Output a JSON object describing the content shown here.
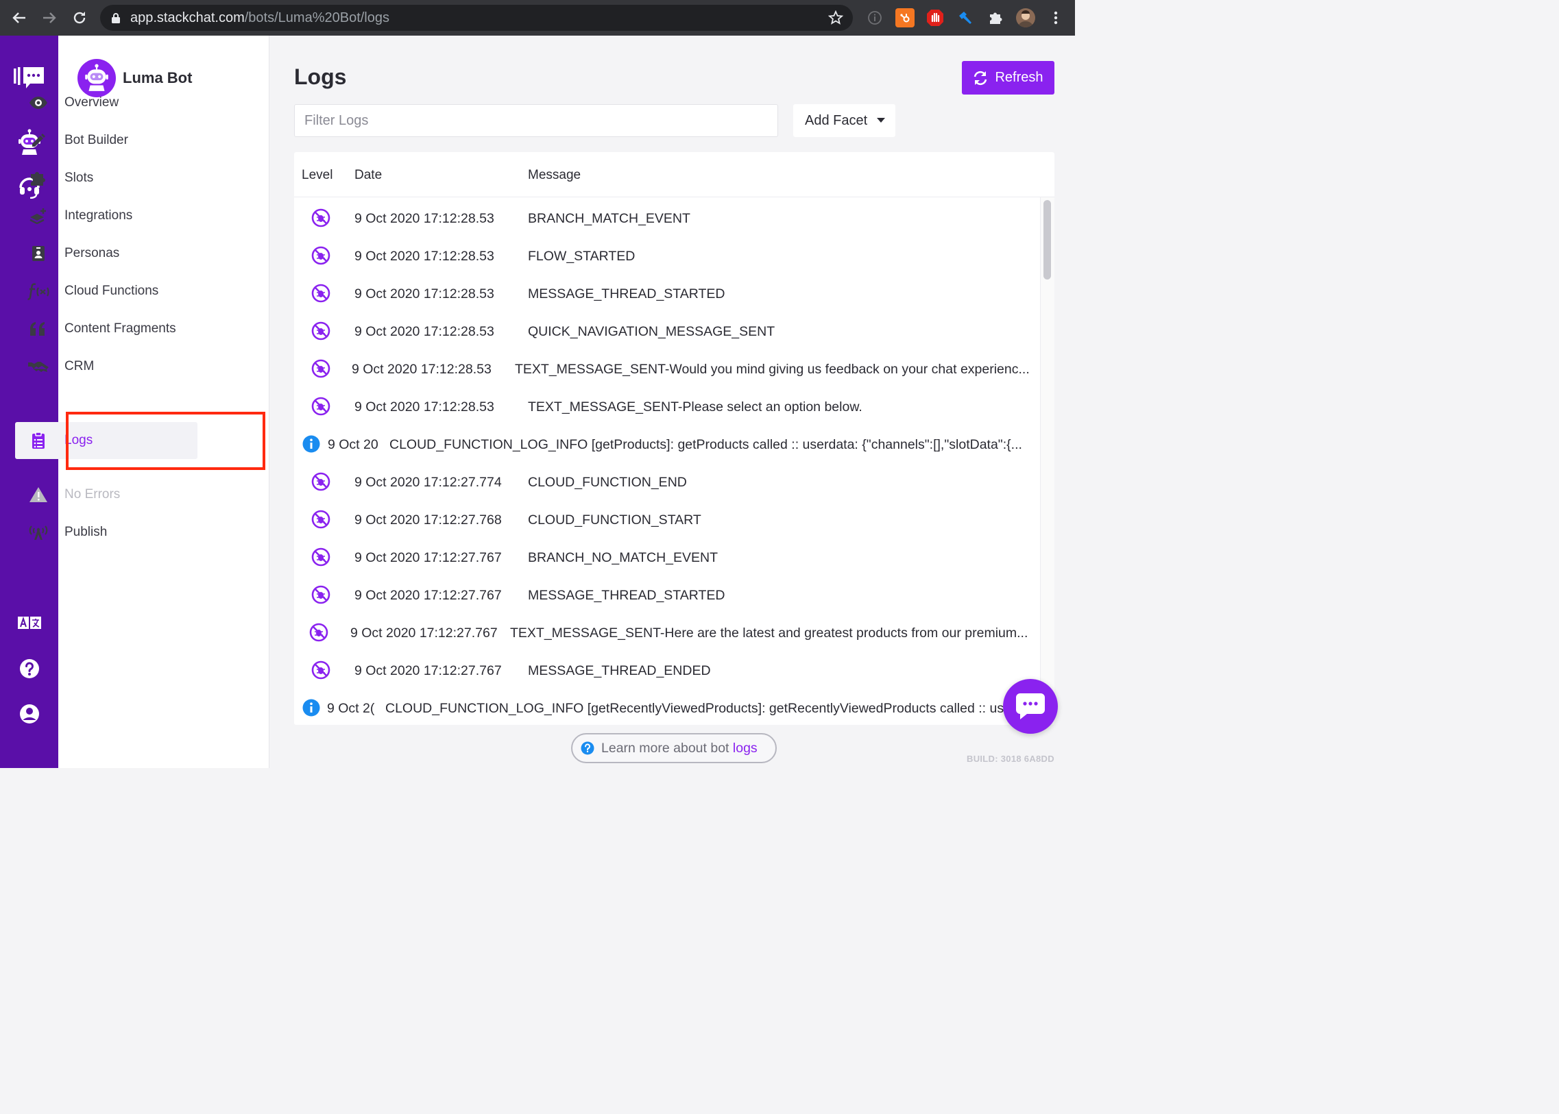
{
  "browser": {
    "url_host": "app.stackchat.com",
    "url_path": "/bots/Luma%20Bot/logs"
  },
  "bot": {
    "name": "Luma Bot"
  },
  "nav": {
    "items": [
      {
        "label": "Overview",
        "icon": "eye-icon"
      },
      {
        "label": "Bot Builder",
        "icon": "pencil-icon"
      },
      {
        "label": "Slots",
        "icon": "puzzle-icon"
      },
      {
        "label": "Integrations",
        "icon": "layers-plus-icon"
      },
      {
        "label": "Personas",
        "icon": "id-badge-icon"
      },
      {
        "label": "Cloud Functions",
        "icon": "function-icon"
      },
      {
        "label": "Content Fragments",
        "icon": "quote-icon"
      },
      {
        "label": "CRM",
        "icon": "handshake-icon"
      },
      {
        "label": "Logs",
        "icon": "clipboard-list-icon",
        "active": true
      }
    ],
    "errors_label": "No Errors",
    "publish_label": "Publish"
  },
  "main": {
    "title": "Logs",
    "refresh_label": "Refresh",
    "filter_placeholder": "Filter Logs",
    "facet_label": "Add Facet"
  },
  "table": {
    "headers": {
      "level": "Level",
      "date": "Date",
      "message": "Message"
    },
    "rows": [
      {
        "level": "debug",
        "date": "9 Oct 2020 17:12:28.53",
        "message": "BRANCH_MATCH_EVENT"
      },
      {
        "level": "debug",
        "date": "9 Oct 2020 17:12:28.53",
        "message": "FLOW_STARTED"
      },
      {
        "level": "debug",
        "date": "9 Oct 2020 17:12:28.53",
        "message": "MESSAGE_THREAD_STARTED"
      },
      {
        "level": "debug",
        "date": "9 Oct 2020 17:12:28.53",
        "message": "QUICK_NAVIGATION_MESSAGE_SENT"
      },
      {
        "level": "debug",
        "date": "9 Oct 2020 17:12:28.53",
        "message": "TEXT_MESSAGE_SENT-Would you mind giving us feedback on your chat experienc..."
      },
      {
        "level": "debug",
        "date": "9 Oct 2020 17:12:28.53",
        "message": "TEXT_MESSAGE_SENT-Please select an option below."
      },
      {
        "level": "info",
        "date": "9 Oct 20",
        "message": "CLOUD_FUNCTION_LOG_INFO [getProducts]: getProducts called :: userdata: {\"channels\":[],\"slotData\":{..."
      },
      {
        "level": "debug",
        "date": "9 Oct 2020 17:12:27.774",
        "message": "CLOUD_FUNCTION_END"
      },
      {
        "level": "debug",
        "date": "9 Oct 2020 17:12:27.768",
        "message": "CLOUD_FUNCTION_START"
      },
      {
        "level": "debug",
        "date": "9 Oct 2020 17:12:27.767",
        "message": "BRANCH_NO_MATCH_EVENT"
      },
      {
        "level": "debug",
        "date": "9 Oct 2020 17:12:27.767",
        "message": "MESSAGE_THREAD_STARTED"
      },
      {
        "level": "debug",
        "date": "9 Oct 2020 17:12:27.767",
        "message": "TEXT_MESSAGE_SENT-Here are the latest and greatest products from our premium..."
      },
      {
        "level": "debug",
        "date": "9 Oct 2020 17:12:27.767",
        "message": "MESSAGE_THREAD_ENDED"
      },
      {
        "level": "info",
        "date": "9 Oct 2(",
        "message": "CLOUD_FUNCTION_LOG_INFO [getRecentlyViewedProducts]: getRecentlyViewedProducts called :: us"
      }
    ]
  },
  "footer": {
    "learn_prefix": "Learn more about bot",
    "learn_link": "logs",
    "build": "BUILD: 3018 6A8DD"
  },
  "colors": {
    "brand": "#8a22ef",
    "rail": "#5a0fa8",
    "info": "#1a8cf0",
    "highlight": "#ff2a10"
  }
}
